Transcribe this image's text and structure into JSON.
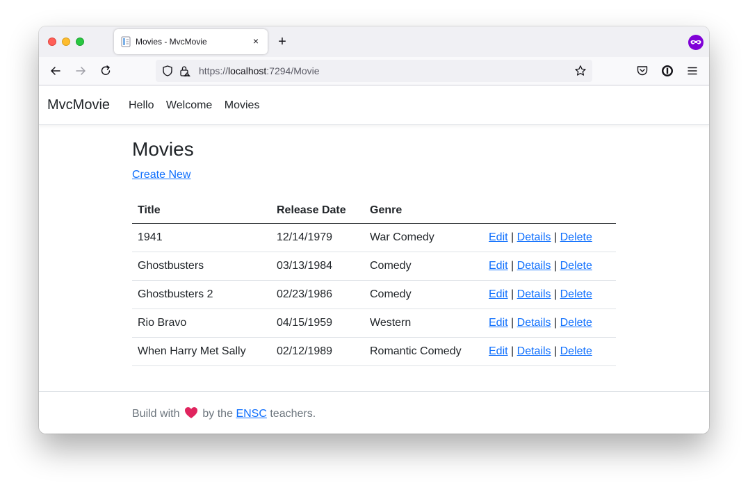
{
  "browser": {
    "tab_title": "Movies - MvcMovie",
    "tab_close": "×",
    "new_tab": "+",
    "url_scheme": "https://",
    "url_host": "localhost",
    "url_rest": ":7294/Movie"
  },
  "site": {
    "brand": "MvcMovie",
    "nav": [
      "Hello",
      "Welcome",
      "Movies"
    ]
  },
  "main": {
    "title": "Movies",
    "create_link": "Create New",
    "columns": [
      "Title",
      "Release Date",
      "Genre"
    ],
    "actions": {
      "edit": "Edit",
      "details": "Details",
      "delete": "Delete",
      "separator": "|"
    },
    "rows": [
      {
        "title": "1941",
        "release_date": "12/14/1979",
        "genre": "War Comedy"
      },
      {
        "title": "Ghostbusters",
        "release_date": "03/13/1984",
        "genre": "Comedy"
      },
      {
        "title": "Ghostbusters 2",
        "release_date": "02/23/1986",
        "genre": "Comedy"
      },
      {
        "title": "Rio Bravo",
        "release_date": "04/15/1959",
        "genre": "Western"
      },
      {
        "title": "When Harry Met Sally",
        "release_date": "02/12/1989",
        "genre": "Romantic Comedy"
      }
    ]
  },
  "footer": {
    "prefix": "Build with",
    "middle": "by the",
    "link": "ENSC",
    "suffix": "teachers."
  },
  "colors": {
    "link": "#0d6efd",
    "heart": "#e0245e",
    "extension": "#8000d7"
  }
}
